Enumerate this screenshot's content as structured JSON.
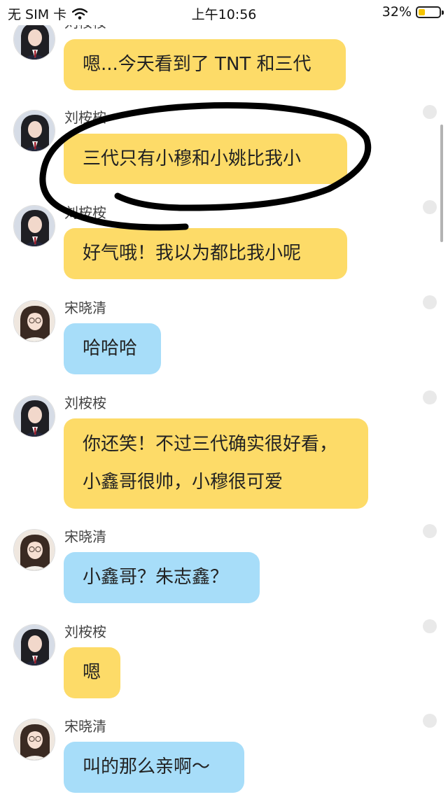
{
  "status_bar": {
    "carrier": "无 SIM 卡",
    "time": "上午10:56",
    "battery": "32%",
    "battery_level": 0.32,
    "wifi_icon": "wifi-icon"
  },
  "messages": [
    {
      "sender": "刘桉桉",
      "text": "嗯...今天看到了 TNT 和三代",
      "avatar": "avatar-liu"
    },
    {
      "sender": "刘桉桉",
      "text": "三代只有小穆和小姚比我小",
      "avatar": "avatar-liu"
    },
    {
      "sender": "刘桉桉",
      "text": "好气哦！我以为都比我小呢",
      "avatar": "avatar-liu"
    },
    {
      "sender": "宋晓清",
      "text": "哈哈哈",
      "avatar": "avatar-song"
    },
    {
      "sender": "刘桉桉",
      "text": "你还笑！不过三代确实很好看，小鑫哥很帅，小穆很可爱",
      "avatar": "avatar-liu"
    },
    {
      "sender": "宋晓清",
      "text": "小鑫哥？朱志鑫？",
      "avatar": "avatar-song"
    },
    {
      "sender": "刘桉桉",
      "text": "嗯",
      "avatar": "avatar-liu"
    },
    {
      "sender": "宋晓清",
      "text": "叫的那么亲啊～",
      "avatar": "avatar-song"
    }
  ],
  "colors": {
    "bubble_liu": "#fddb68",
    "bubble_song": "#a7ddf9",
    "annotation": "#000000"
  }
}
